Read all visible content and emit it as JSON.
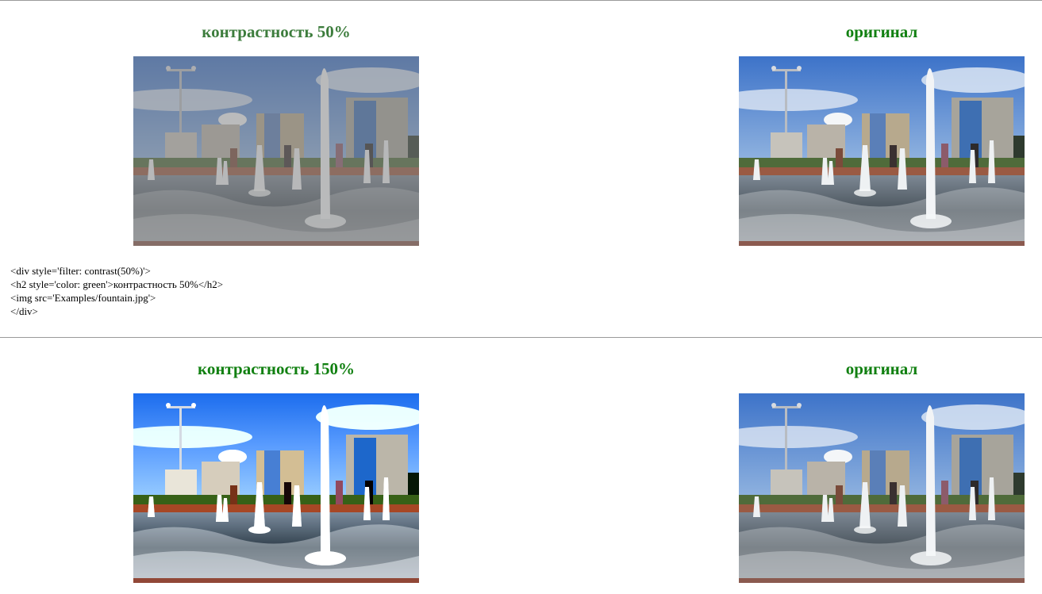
{
  "section1": {
    "left_heading": "контрастность 50%",
    "right_heading": "оригинал",
    "left_image_filter": "contrast(50%)",
    "code_lines": [
      "<div style='filter: contrast(50%)'>",
      "<h2 style='color: green'>контрастность 50%</h2>",
      "<img src='Examples/fountain.jpg'>",
      "</div>"
    ]
  },
  "section2": {
    "left_heading": "контрастность 150%",
    "right_heading": "оригинал",
    "left_image_filter": "contrast(150%)"
  },
  "colors": {
    "heading_green": "#118011",
    "rule_gray": "#9a9a9a"
  },
  "image_subject": "fountain"
}
